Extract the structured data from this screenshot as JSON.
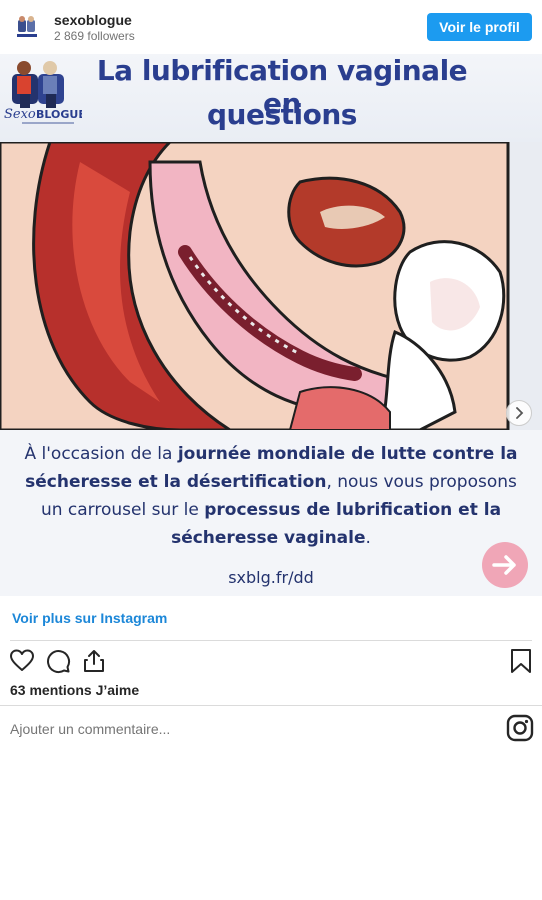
{
  "header": {
    "username": "sexoblogue",
    "followers": "2 869 followers",
    "profile_button": "Voir le profil"
  },
  "post_image": {
    "title_line1": "La lubrification vaginale en",
    "title_line2": "questions",
    "logo_text": "Sexo BLOGUE",
    "caption_line1_pre": "À l'occasion de la ",
    "caption_line1_bold": "journée mondiale de lutte contre la",
    "caption_line2_bold": "sécheresse et la désertification",
    "caption_line2_post": ", nous vous proposons",
    "caption_line3_pre": "un carrousel sur le ",
    "caption_line3_bold": "processus de lubrification et la",
    "caption_line4_bold": "sécheresse vaginale",
    "caption_line4_post": ".",
    "url": "sxblg.fr/dd"
  },
  "links": {
    "more_on_instagram": "Voir plus sur Instagram"
  },
  "engagement": {
    "likes": "63 mentions J’aime"
  },
  "comment_box": {
    "placeholder": "Ajouter un commentaire..."
  },
  "icons": {
    "like": "heart-icon",
    "comment": "comment-icon",
    "share": "share-icon",
    "save": "bookmark-icon",
    "brand": "instagram-icon",
    "next": "chevron-right-icon"
  },
  "colors": {
    "primary_button": "#1c9bf0",
    "link": "#1c87d8",
    "title_blue": "#2a3e8f"
  }
}
